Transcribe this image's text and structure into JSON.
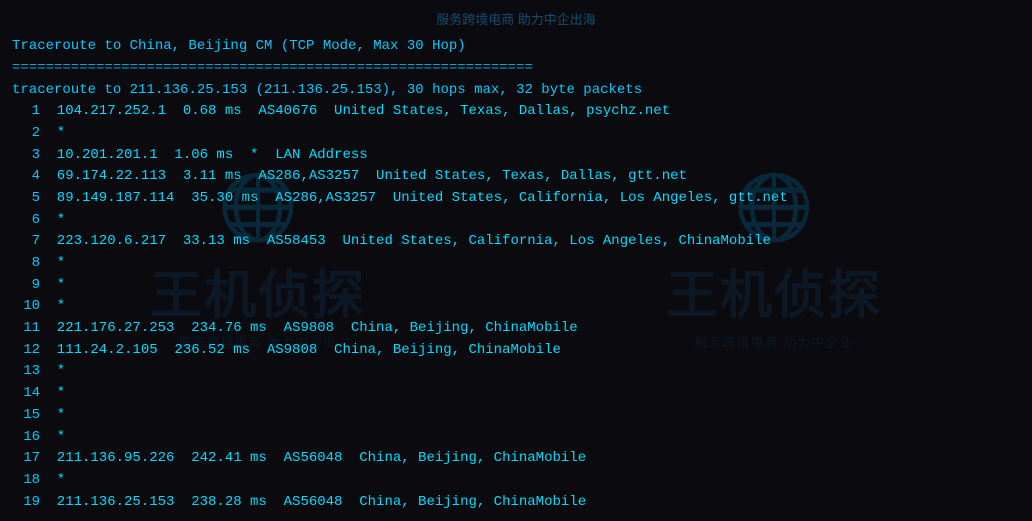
{
  "banner": {
    "text": "服务跨境电商 助力中企出海"
  },
  "terminal": {
    "title": "Traceroute to China, Beijing CM (TCP Mode, Max 30 Hop)",
    "separator": "==============================================================",
    "info_line": "traceroute to 211.136.25.153 (211.136.25.153), 30 hops max, 32 byte packets",
    "hops": [
      {
        "num": "1",
        "content": "  104.217.252.1  0.68 ms  AS40676  United States, Texas, Dallas, psychz.net"
      },
      {
        "num": "2",
        "content": "  *"
      },
      {
        "num": "3",
        "content": "  10.201.201.1  1.06 ms  *  LAN Address"
      },
      {
        "num": "4",
        "content": "  69.174.22.113  3.11 ms  AS286,AS3257  United States, Texas, Dallas, gtt.net"
      },
      {
        "num": "5",
        "content": "  89.149.187.114  35.30 ms  AS286,AS3257  United States, California, Los Angeles, gtt.net"
      },
      {
        "num": "6",
        "content": "  *"
      },
      {
        "num": "7",
        "content": "  223.120.6.217  33.13 ms  AS58453  United States, California, Los Angeles, ChinaMobile"
      },
      {
        "num": "8",
        "content": "  *"
      },
      {
        "num": "9",
        "content": "  *"
      },
      {
        "num": "10",
        "content": "  *"
      },
      {
        "num": "11",
        "content": "  221.176.27.253  234.76 ms  AS9808  China, Beijing, ChinaMobile"
      },
      {
        "num": "12",
        "content": "  111.24.2.105  236.52 ms  AS9808  China, Beijing, ChinaMobile"
      },
      {
        "num": "13",
        "content": "  *"
      },
      {
        "num": "14",
        "content": "  *"
      },
      {
        "num": "15",
        "content": "  *"
      },
      {
        "num": "16",
        "content": "  *"
      },
      {
        "num": "17",
        "content": "  211.136.95.226  242.41 ms  AS56048  China, Beijing, ChinaMobile"
      },
      {
        "num": "18",
        "content": "  *"
      },
      {
        "num": "19",
        "content": "  211.136.25.153  238.28 ms  AS56048  China, Beijing, ChinaMobile"
      }
    ]
  },
  "watermarks": [
    {
      "main": "王机侦探",
      "sub": "服务跨境电商 助力中企业"
    },
    {
      "main": "王机侦探",
      "sub": "服务跨境电商 助力中企业"
    }
  ]
}
